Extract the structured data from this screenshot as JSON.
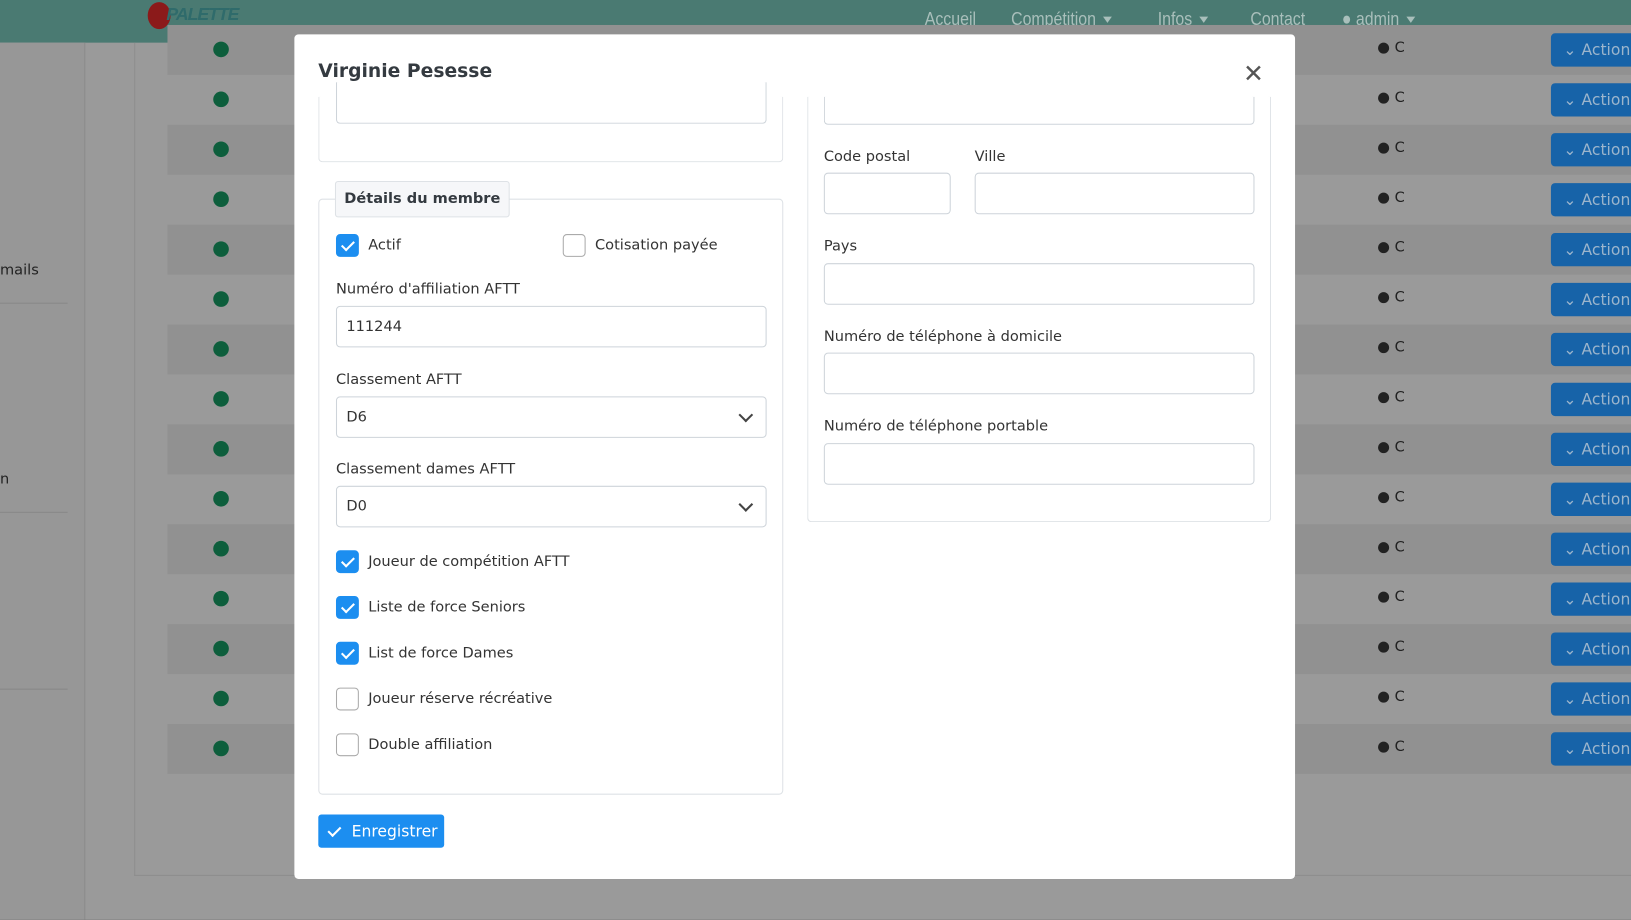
{
  "navbar": {
    "logo_text": "PALETTE",
    "items": [
      "Accueil",
      "Compétition",
      "Infos",
      "Contact"
    ],
    "user": "admin"
  },
  "sidebar": {
    "items": [
      "mails",
      "n"
    ]
  },
  "table": {
    "rows": [
      {
        "status": "active",
        "ranking": "C",
        "action": "Actions"
      },
      {
        "status": "active",
        "ranking": "C",
        "action": "Actions"
      },
      {
        "status": "active",
        "ranking": "C",
        "action": "Actions"
      },
      {
        "status": "active",
        "ranking": "C",
        "action": "Actions"
      },
      {
        "status": "active",
        "ranking": "C",
        "action": "Actions"
      },
      {
        "status": "active",
        "ranking": "C",
        "action": "Actions"
      },
      {
        "status": "active",
        "ranking": "C",
        "action": "Actions"
      },
      {
        "status": "active",
        "ranking": "C",
        "action": "Actions"
      },
      {
        "status": "active",
        "ranking": "C",
        "action": "Actions"
      },
      {
        "status": "active",
        "ranking": "C",
        "action": "Actions"
      },
      {
        "status": "active",
        "ranking": "C",
        "action": "Actions"
      },
      {
        "status": "active",
        "ranking": "C",
        "action": "Actions"
      },
      {
        "status": "active",
        "ranking": "C",
        "action": "Actions"
      },
      {
        "status": "active",
        "ranking": "C",
        "action": "Actions"
      },
      {
        "status": "active",
        "ranking": "C",
        "action": "Actions"
      }
    ]
  },
  "modal": {
    "title": "Virginie Pesesse",
    "legend": "Détails du membre",
    "actif": {
      "label": "Actif",
      "checked": true
    },
    "cotisation": {
      "label": "Cotisation payée",
      "checked": false
    },
    "affiliation": {
      "label": "Numéro d'affiliation AFTT",
      "value": "111244"
    },
    "classement": {
      "label": "Classement AFTT",
      "value": "D6"
    },
    "classement_dames": {
      "label": "Classement dames AFTT",
      "value": "D0"
    },
    "checks": [
      {
        "label": "Joueur de compétition AFTT",
        "checked": true
      },
      {
        "label": "Liste de force Seniors",
        "checked": true
      },
      {
        "label": "List de force Dames",
        "checked": true
      },
      {
        "label": "Joueur réserve récréative",
        "checked": false
      },
      {
        "label": "Double affiliation",
        "checked": false
      }
    ],
    "code_postal": {
      "label": "Code postal",
      "value": ""
    },
    "ville": {
      "label": "Ville",
      "value": ""
    },
    "pays": {
      "label": "Pays",
      "value": ""
    },
    "tel_domicile": {
      "label": "Numéro de téléphone à domicile",
      "value": ""
    },
    "tel_portable": {
      "label": "Numéro de téléphone portable",
      "value": ""
    },
    "save_label": "Enregistrer"
  }
}
